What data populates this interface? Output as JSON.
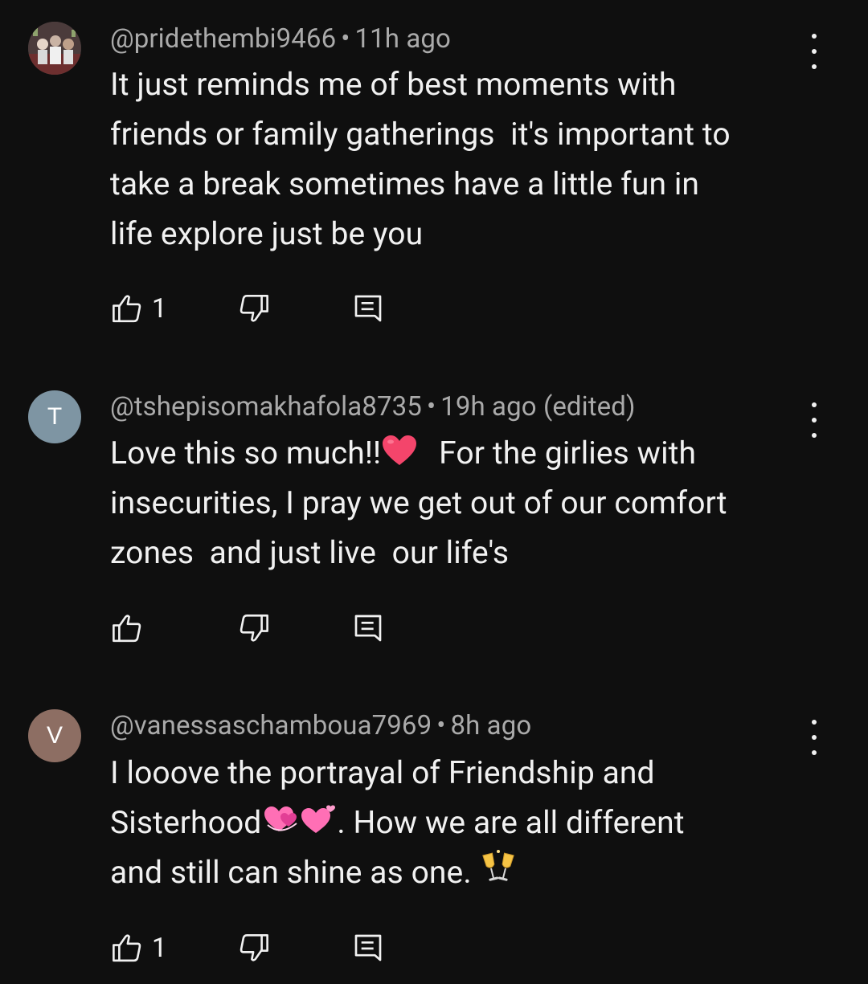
{
  "comments": [
    {
      "handle": "@pridethembi9466",
      "separator": "•",
      "time": "11h ago",
      "edited": "",
      "avatar_letter": "",
      "text_lines": [
        "It just reminds me of best moments with",
        "friends or family gatherings  it's important to",
        "take a break sometimes have a little fun in",
        "life explore just be you"
      ],
      "likes": "1"
    },
    {
      "handle": "@tshepisomakhafola8735",
      "separator": "•",
      "time": "19h ago",
      "edited": "(edited)",
      "avatar_letter": "T",
      "avatar_color": "#7e95a3",
      "text_lines": [
        "Love this so much!!",
        "For the girlies with",
        "insecurities, I pray we get out of our comfort",
        "zones  and just live  our life's"
      ],
      "likes": ""
    },
    {
      "handle": "@vanessaschamboua7969",
      "separator": "•",
      "time": "8h ago",
      "edited": "",
      "avatar_letter": "V",
      "avatar_color": "#8d6e63",
      "text_lines": [
        "I looove the portrayal of Friendship and",
        "Sisterhood",
        ". How we are all different",
        "and still can shine as one. "
      ],
      "likes": "1"
    }
  ],
  "icons": {
    "like": "thumbs-up-icon",
    "dislike": "thumbs-down-icon",
    "reply": "reply-comment-icon",
    "menu": "more-vertical-icon"
  },
  "colors": {
    "background": "#0f0f0f",
    "text": "#f1f1f1",
    "meta": "#aaaaaa"
  }
}
